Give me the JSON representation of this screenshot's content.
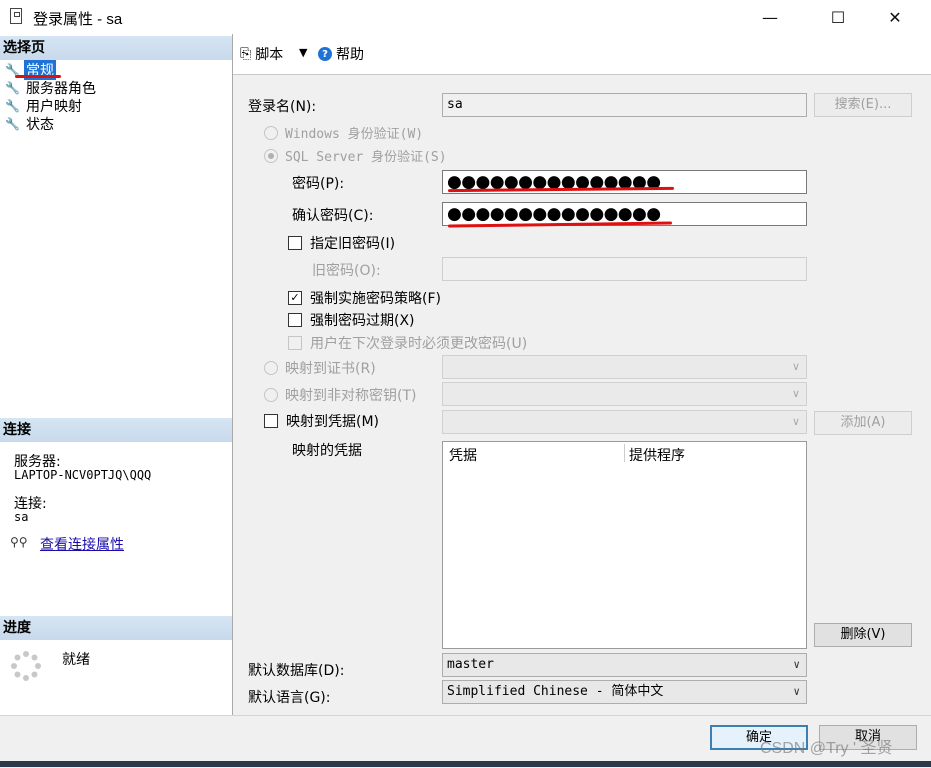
{
  "window": {
    "title": "登录属性 - sa",
    "minimize_glyph": "—",
    "maximize_glyph": "☐",
    "close_glyph": "✕"
  },
  "left_pane": {
    "select_page_header": "选择页",
    "pages": [
      {
        "label": "常规",
        "selected": true
      },
      {
        "label": "服务器角色",
        "selected": false
      },
      {
        "label": "用户映射",
        "selected": false
      },
      {
        "label": "状态",
        "selected": false
      }
    ],
    "connection_header": "连接",
    "server_label": "服务器:",
    "server_value": "LAPTOP-NCV0PTJQ\\QQQ",
    "connection_label": "连接:",
    "connection_value": "sa",
    "view_connection_properties": "查看连接属性",
    "progress_header": "进度",
    "progress_status": "就绪"
  },
  "toolbar": {
    "script_label": "脚本",
    "help_label": "帮助"
  },
  "form": {
    "login_name_label": "登录名(N):",
    "login_name_value": "sa",
    "search_button": "搜索(E)...",
    "windows_auth_label": "Windows 身份验证(W)",
    "sql_auth_label": "SQL Server 身份验证(S)",
    "password_label": "密码(P):",
    "password_value": "●●●●●●●●●●●●●●●",
    "confirm_password_label": "确认密码(C):",
    "confirm_password_value": "●●●●●●●●●●●●●●●",
    "specify_old_password_label": "指定旧密码(I)",
    "old_password_label": "旧密码(O):",
    "enforce_policy_label": "强制实施密码策略(F)",
    "enforce_policy_checked": true,
    "enforce_expiration_label": "强制密码过期(X)",
    "must_change_label": "用户在下次登录时必须更改密码(U)",
    "map_to_certificate_label": "映射到证书(R)",
    "map_to_asym_key_label": "映射到非对称密钥(T)",
    "map_to_credential_label": "映射到凭据(M)",
    "add_button": "添加(A)",
    "mapped_credentials_label": "映射的凭据",
    "credentials_columns": [
      "凭据",
      "提供程序"
    ],
    "remove_button": "删除(V)",
    "default_database_label": "默认数据库(D):",
    "default_database_value": "master",
    "default_language_label": "默认语言(G):",
    "default_language_value": "Simplified Chinese - 简体中文"
  },
  "footer": {
    "ok_button": "确定",
    "cancel_button": "取消",
    "watermark": "CSDN @Try ' 圣贤"
  },
  "colors": {
    "accent_selected": "#1e73d4",
    "annotation_red": "#dd1111",
    "section_header": "#c7d9ec"
  }
}
